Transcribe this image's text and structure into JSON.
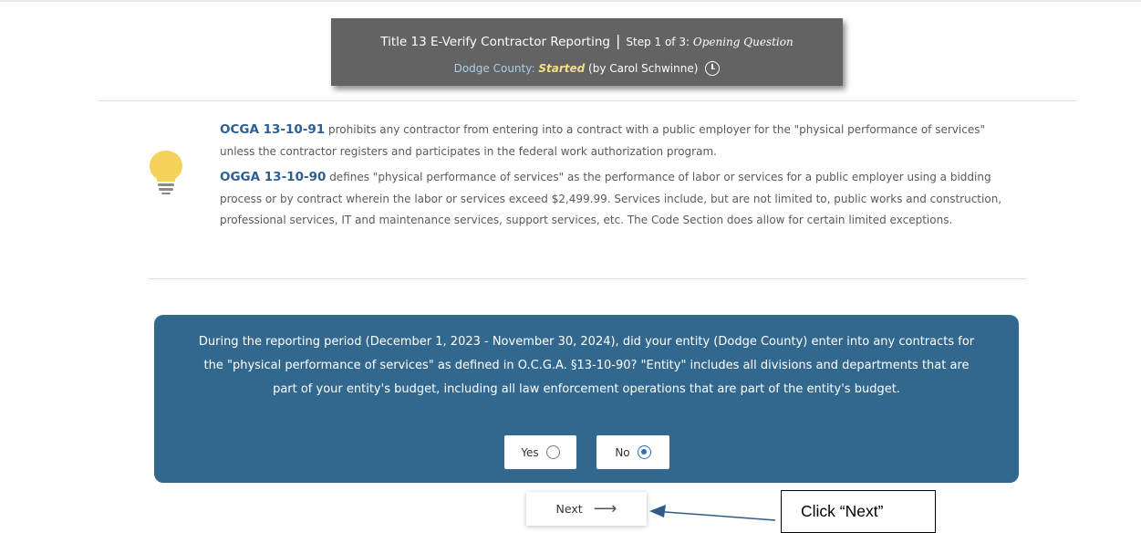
{
  "header": {
    "title": "Title 13 E-Verify Contractor Reporting",
    "separator": "|",
    "step": "Step 1 of 3:",
    "step_name": "Opening Question",
    "county": "Dodge County:",
    "status": "Started",
    "started_by": "(by Carol Schwinne)"
  },
  "info": {
    "icon": "lightbulb-icon",
    "para1_code": "OCGA 13-10-91",
    "para1_text": "prohibits any contractor from entering into a contract with a public employer for the \"physical performance of services\" unless the contractor registers and participates in the federal work authorization program.",
    "para2_code": "OGGA 13-10-90",
    "para2_text": "defines \"physical performance of services\" as the performance of labor or services for a public employer using a bidding process or by contract wherein the labor or services exceed $2,499.99. Services include, but are not limited to, public works and construction, professional services, IT and maintenance services, support services, etc. The Code Section does allow for certain limited exceptions."
  },
  "question": {
    "text": "During the reporting period (December 1, 2023 - November 30, 2024), did your entity (Dodge County) enter into any contracts for the \"physical performance of services\" as defined in O.C.G.A. §13-10-90? \"Entity\" includes all divisions and departments that are part of your entity's budget, including all law enforcement operations that are part of the entity's budget.",
    "yes_label": "Yes",
    "no_label": "No",
    "selected": "No"
  },
  "next_button": {
    "label": "Next",
    "icon": "arrow-right-icon"
  },
  "annotation": {
    "callout": "Click “Next”"
  },
  "colors": {
    "header_bg": "#636363",
    "question_bg": "#33688e",
    "code_link": "#2e5f92",
    "status": "#f3df86",
    "bulb": "#f5d35a"
  }
}
